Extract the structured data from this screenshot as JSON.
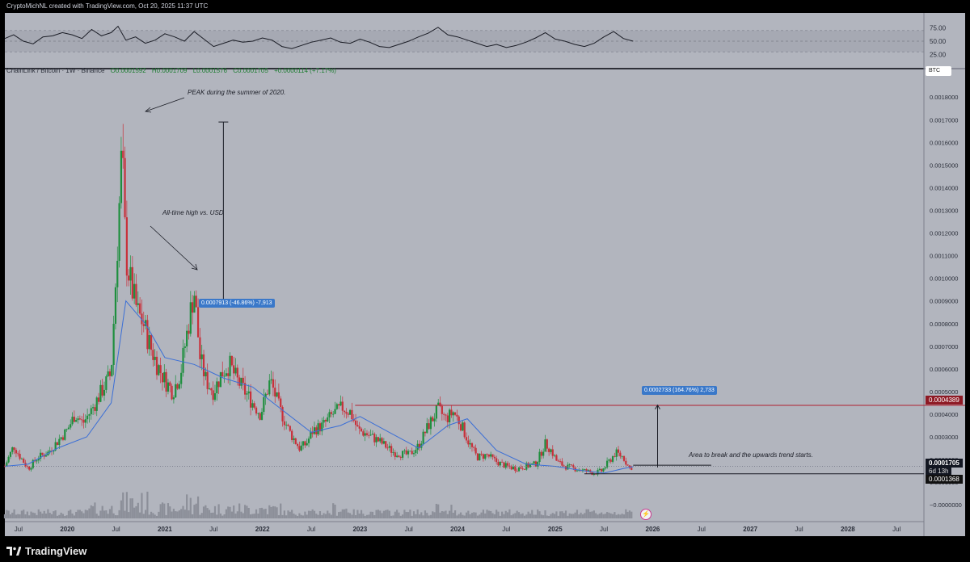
{
  "header": {
    "text": "CryptoMichNL created with TradingView.com, Oct 20, 2025 11:37 UTC"
  },
  "legend": {
    "symbol": "ChainLink / Bitcoin · 1W · Binance",
    "open": "O0.0001592",
    "high": "H0.0001709",
    "low": "L0.0001576",
    "close": "C0.0001705",
    "change": "+0.0000114 (+7.17%)"
  },
  "currency_badge": "BTC",
  "annotations": {
    "peak": "PEAK during the summer of 2020.",
    "ath": "All-time high vs. USD",
    "area": "Area to break and the upwards trend starts.",
    "measure_down": "0.0007913 (-46.86%) -7,913",
    "measure_up": "0.0002733 (164.76%) 2,733"
  },
  "price_tags": {
    "resistance": "0.0004389",
    "current": "0.0001705",
    "countdown": "6d 13h",
    "support": "0.0001368"
  },
  "rsi": {
    "labels": [
      "75.00",
      "50.00",
      "25.00"
    ],
    "upper": 70,
    "lower": 30
  },
  "footer": {
    "brand": "TradingView"
  },
  "colors": {
    "up": "#1e8f3e",
    "down": "#c8303a",
    "ma": "#3b6fd6",
    "resistance": "#b02030",
    "pane": "#b2b5be"
  },
  "chart_data": {
    "type": "line",
    "title": "ChainLink / Bitcoin · 1W · Binance",
    "y_axis_ticks": [
      "0.0018000",
      "0.0017000",
      "0.0016000",
      "0.0015000",
      "0.0014000",
      "0.0013000",
      "0.0012000",
      "0.0011000",
      "0.0010000",
      "0.0009000",
      "0.0008000",
      "0.0007000",
      "0.0006000",
      "0.0005000",
      "0.0004000",
      "0.0003000",
      "0.0002000",
      "0.0001000",
      "−0.0000000"
    ],
    "y_axis_values": [
      0.0018,
      0.0017,
      0.0016,
      0.0015,
      0.0014,
      0.0013,
      0.0012,
      0.0011,
      0.001,
      0.0009,
      0.0008,
      0.0007,
      0.0006,
      0.0005,
      0.0004,
      0.0003,
      0.0002,
      0.0001,
      0.0
    ],
    "ylim": [
      -6e-05,
      0.00189
    ],
    "x_axis_ticks": [
      "Jul",
      "2020",
      "Jul",
      "2021",
      "Jul",
      "2022",
      "Jul",
      "2023",
      "Jul",
      "2024",
      "Jul",
      "2025",
      "Jul",
      "2026",
      "Jul",
      "2027",
      "Jul",
      "2028",
      "Jul"
    ],
    "x_axis_positions": [
      2019.5,
      2020.0,
      2020.5,
      2021.0,
      2021.5,
      2022.0,
      2022.5,
      2023.0,
      2023.5,
      2024.0,
      2024.5,
      2025.0,
      2025.5,
      2026.0,
      2026.5,
      2027.0,
      2027.5,
      2028.0,
      2028.5
    ],
    "xlim": [
      2019.36,
      2028.78
    ],
    "series": [
      {
        "name": "ChainLink / Bitcoin",
        "x": [
          2019.36,
          2019.45,
          2019.52,
          2019.6,
          2019.7,
          2019.8,
          2019.9,
          2020.0,
          2020.08,
          2020.16,
          2020.25,
          2020.35,
          2020.45,
          2020.52,
          2020.56,
          2020.6,
          2020.64,
          2020.68,
          2020.72,
          2020.78,
          2020.85,
          2020.92,
          2021.0,
          2021.08,
          2021.16,
          2021.25,
          2021.3,
          2021.36,
          2021.42,
          2021.5,
          2021.58,
          2021.66,
          2021.74,
          2021.82,
          2021.9,
          2021.98,
          2022.08,
          2022.18,
          2022.28,
          2022.38,
          2022.45,
          2022.52,
          2022.62,
          2022.72,
          2022.82,
          2022.9,
          2022.98,
          2023.08,
          2023.2,
          2023.35,
          2023.5,
          2023.6,
          2023.7,
          2023.8,
          2023.88,
          2023.96,
          2024.04,
          2024.12,
          2024.2,
          2024.3,
          2024.4,
          2024.5,
          2024.6,
          2024.7,
          2024.8,
          2024.9,
          2024.96,
          2025.02,
          2025.1,
          2025.2,
          2025.3,
          2025.4,
          2025.48,
          2025.55,
          2025.62,
          2025.7,
          2025.76,
          2025.8
        ],
        "y": [
          0.00017,
          0.00026,
          0.00021,
          0.00016,
          0.00021,
          0.00023,
          0.00028,
          0.00033,
          0.0004,
          0.00036,
          0.00042,
          0.0005,
          0.00058,
          0.0012,
          0.00158,
          0.0011,
          0.001,
          0.00092,
          0.00085,
          0.0008,
          0.0007,
          0.00062,
          0.00055,
          0.0005,
          0.00058,
          0.00082,
          0.00095,
          0.00065,
          0.00055,
          0.0005,
          0.00058,
          0.00062,
          0.00055,
          0.0005,
          0.00045,
          0.0004,
          0.00055,
          0.00042,
          0.00032,
          0.00025,
          0.00027,
          0.00033,
          0.00035,
          0.0004,
          0.00043,
          0.00041,
          0.00033,
          0.00031,
          0.00028,
          0.00023,
          0.00022,
          0.00026,
          0.00035,
          0.00042,
          0.00038,
          0.00041,
          0.00035,
          0.00027,
          0.00021,
          0.00022,
          0.00019,
          0.00017,
          0.00016,
          0.00017,
          0.00018,
          0.00027,
          0.00024,
          0.00019,
          0.00017,
          0.00016,
          0.00015,
          0.00014,
          0.00015,
          0.00019,
          0.00023,
          0.00021,
          0.00016,
          0.000171
        ]
      },
      {
        "name": "Moving Average",
        "x": [
          2019.36,
          2019.6,
          2019.9,
          2020.2,
          2020.45,
          2020.6,
          2020.8,
          2021.0,
          2021.3,
          2021.6,
          2021.9,
          2022.2,
          2022.5,
          2022.8,
          2023.0,
          2023.3,
          2023.6,
          2023.9,
          2024.1,
          2024.4,
          2024.7,
          2025.0,
          2025.3,
          2025.5,
          2025.7,
          2025.8
        ],
        "y": [
          0.00017,
          0.00018,
          0.00025,
          0.0003,
          0.00045,
          0.0009,
          0.0008,
          0.00065,
          0.00062,
          0.00056,
          0.00052,
          0.00042,
          0.00032,
          0.00035,
          0.00039,
          0.00032,
          0.00025,
          0.00035,
          0.00038,
          0.00024,
          0.00018,
          0.00017,
          0.00015,
          0.00014,
          0.00016,
          0.000168
        ]
      }
    ],
    "rsi_series": {
      "x": [
        2019.36,
        2019.45,
        2019.55,
        2019.65,
        2019.75,
        2019.85,
        2019.95,
        2020.05,
        2020.15,
        2020.25,
        2020.35,
        2020.45,
        2020.52,
        2020.6,
        2020.7,
        2020.8,
        2020.9,
        2021.0,
        2021.1,
        2021.2,
        2021.3,
        2021.4,
        2021.5,
        2021.6,
        2021.7,
        2021.8,
        2021.9,
        2022.0,
        2022.1,
        2022.2,
        2022.3,
        2022.4,
        2022.5,
        2022.6,
        2022.7,
        2022.8,
        2022.9,
        2023.0,
        2023.1,
        2023.2,
        2023.3,
        2023.4,
        2023.5,
        2023.6,
        2023.7,
        2023.8,
        2023.9,
        2024.0,
        2024.1,
        2024.2,
        2024.3,
        2024.4,
        2024.5,
        2024.6,
        2024.7,
        2024.8,
        2024.9,
        2025.0,
        2025.1,
        2025.2,
        2025.3,
        2025.4,
        2025.5,
        2025.6,
        2025.7,
        2025.8
      ],
      "y": [
        55,
        62,
        50,
        45,
        58,
        60,
        66,
        62,
        55,
        72,
        60,
        66,
        78,
        52,
        58,
        46,
        52,
        64,
        58,
        50,
        68,
        54,
        40,
        46,
        52,
        48,
        50,
        56,
        52,
        40,
        36,
        42,
        48,
        52,
        56,
        48,
        46,
        54,
        48,
        40,
        38,
        44,
        50,
        58,
        65,
        76,
        62,
        58,
        52,
        46,
        40,
        44,
        38,
        42,
        48,
        56,
        66,
        54,
        50,
        44,
        40,
        46,
        58,
        68,
        55,
        50
      ]
    }
  }
}
